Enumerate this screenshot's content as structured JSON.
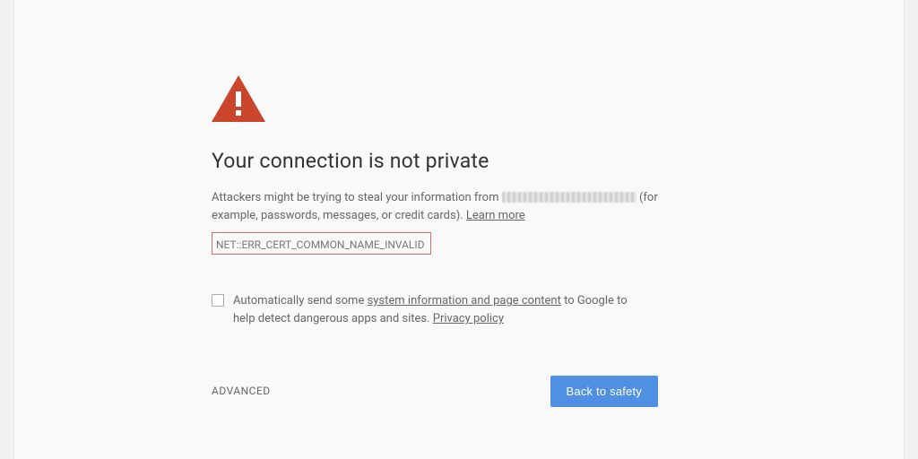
{
  "icon": {
    "name": "warning-triangle",
    "color": "#c9452b"
  },
  "heading": "Your connection is not private",
  "message": {
    "prefix": "Attackers might be trying to steal your information from ",
    "suffix_after_host": " (for example, passwords, messages, or credit cards). ",
    "learn_more": "Learn more"
  },
  "error_code": "NET::ERR_CERT_COMMON_NAME_INVALID",
  "report": {
    "pre": "Automatically send some ",
    "link1": "system information and page content",
    "mid": " to Google to help detect dangerous apps and sites. ",
    "privacy": "Privacy policy",
    "checked": false
  },
  "footer": {
    "advanced": "ADVANCED",
    "back_to_safety": "Back to safety"
  }
}
